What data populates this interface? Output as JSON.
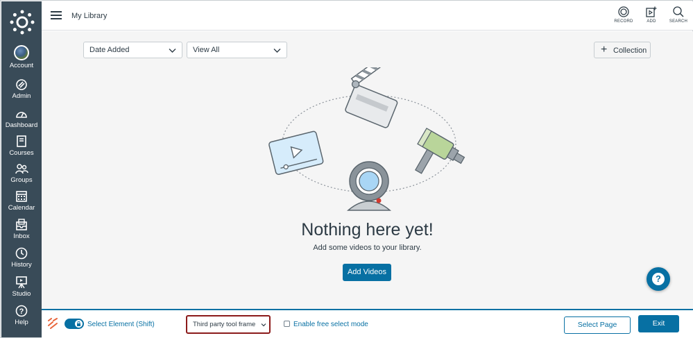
{
  "global_nav": {
    "items": [
      {
        "label": "Account",
        "icon": "avatar"
      },
      {
        "label": "Admin",
        "icon": "admin-shield-icon"
      },
      {
        "label": "Dashboard",
        "icon": "dashboard-gauge-icon"
      },
      {
        "label": "Courses",
        "icon": "courses-book-icon"
      },
      {
        "label": "Groups",
        "icon": "groups-people-icon"
      },
      {
        "label": "Calendar",
        "icon": "calendar-icon"
      },
      {
        "label": "Inbox",
        "icon": "inbox-icon"
      },
      {
        "label": "History",
        "icon": "history-clock-icon"
      },
      {
        "label": "Studio",
        "icon": "studio-easel-icon"
      },
      {
        "label": "Help",
        "icon": "help-question-icon"
      }
    ]
  },
  "header": {
    "title": "My Library",
    "actions": [
      {
        "label": "RECORD",
        "icon": "record-icon"
      },
      {
        "label": "ADD",
        "icon": "add-media-icon"
      },
      {
        "label": "SEARCH",
        "icon": "search-icon"
      }
    ]
  },
  "filters": {
    "sort": {
      "value": "Date Added"
    },
    "view": {
      "value": "View All"
    },
    "collection_button": "Collection"
  },
  "empty_state": {
    "title": "Nothing here yet!",
    "subtitle": "Add some videos to your library.",
    "button": "Add Videos"
  },
  "bottom_toolbar": {
    "toggle_label": "Select Element (Shift)",
    "frame_select_value": "Third party tool frame",
    "checkbox_label": "Enable free select mode",
    "select_page_button": "Select Page",
    "exit_button": "Exit"
  },
  "colors": {
    "nav_bg": "#394b58",
    "brand_blue": "#0770a3",
    "content_bg": "#f5f5f5",
    "highlight_border": "#8b1a1a"
  }
}
